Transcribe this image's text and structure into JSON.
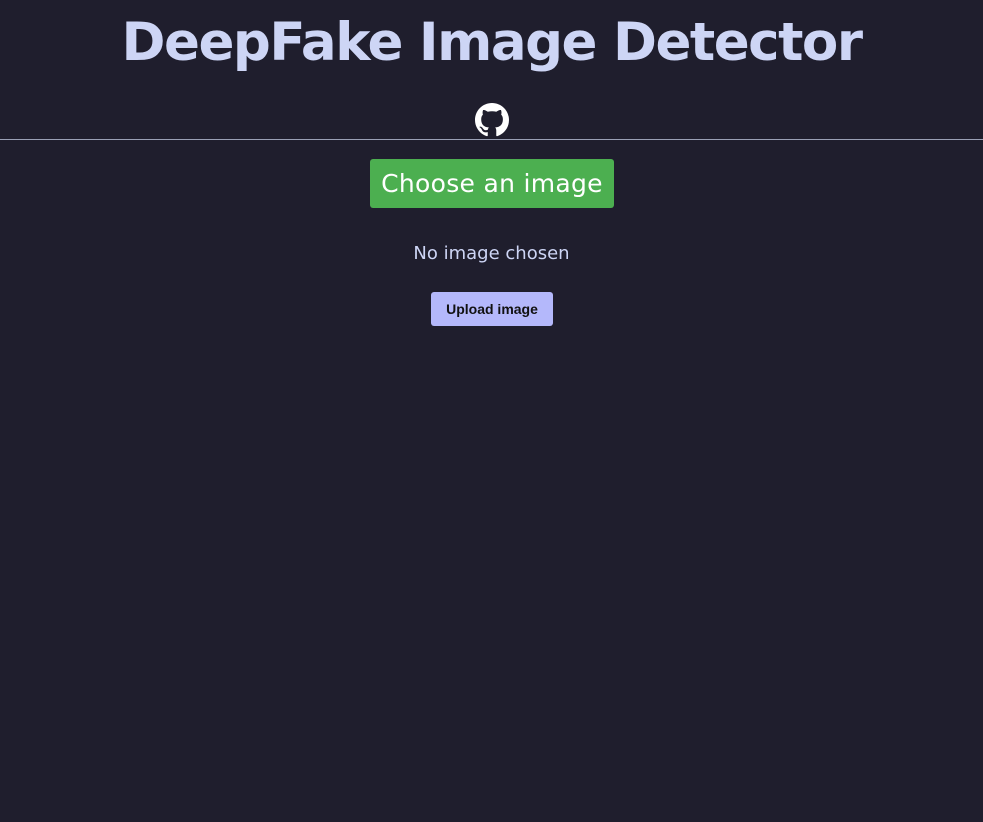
{
  "header": {
    "title": "DeepFake Image Detector",
    "github_icon": "github-icon"
  },
  "upload": {
    "choose_label": "Choose an image",
    "status_text": "No image chosen",
    "upload_label": "Upload image"
  },
  "colors": {
    "background": "#1f1e2d",
    "title_text": "#cdd5f5",
    "choose_button": "#4caf50",
    "upload_button": "#b4b8fb"
  }
}
